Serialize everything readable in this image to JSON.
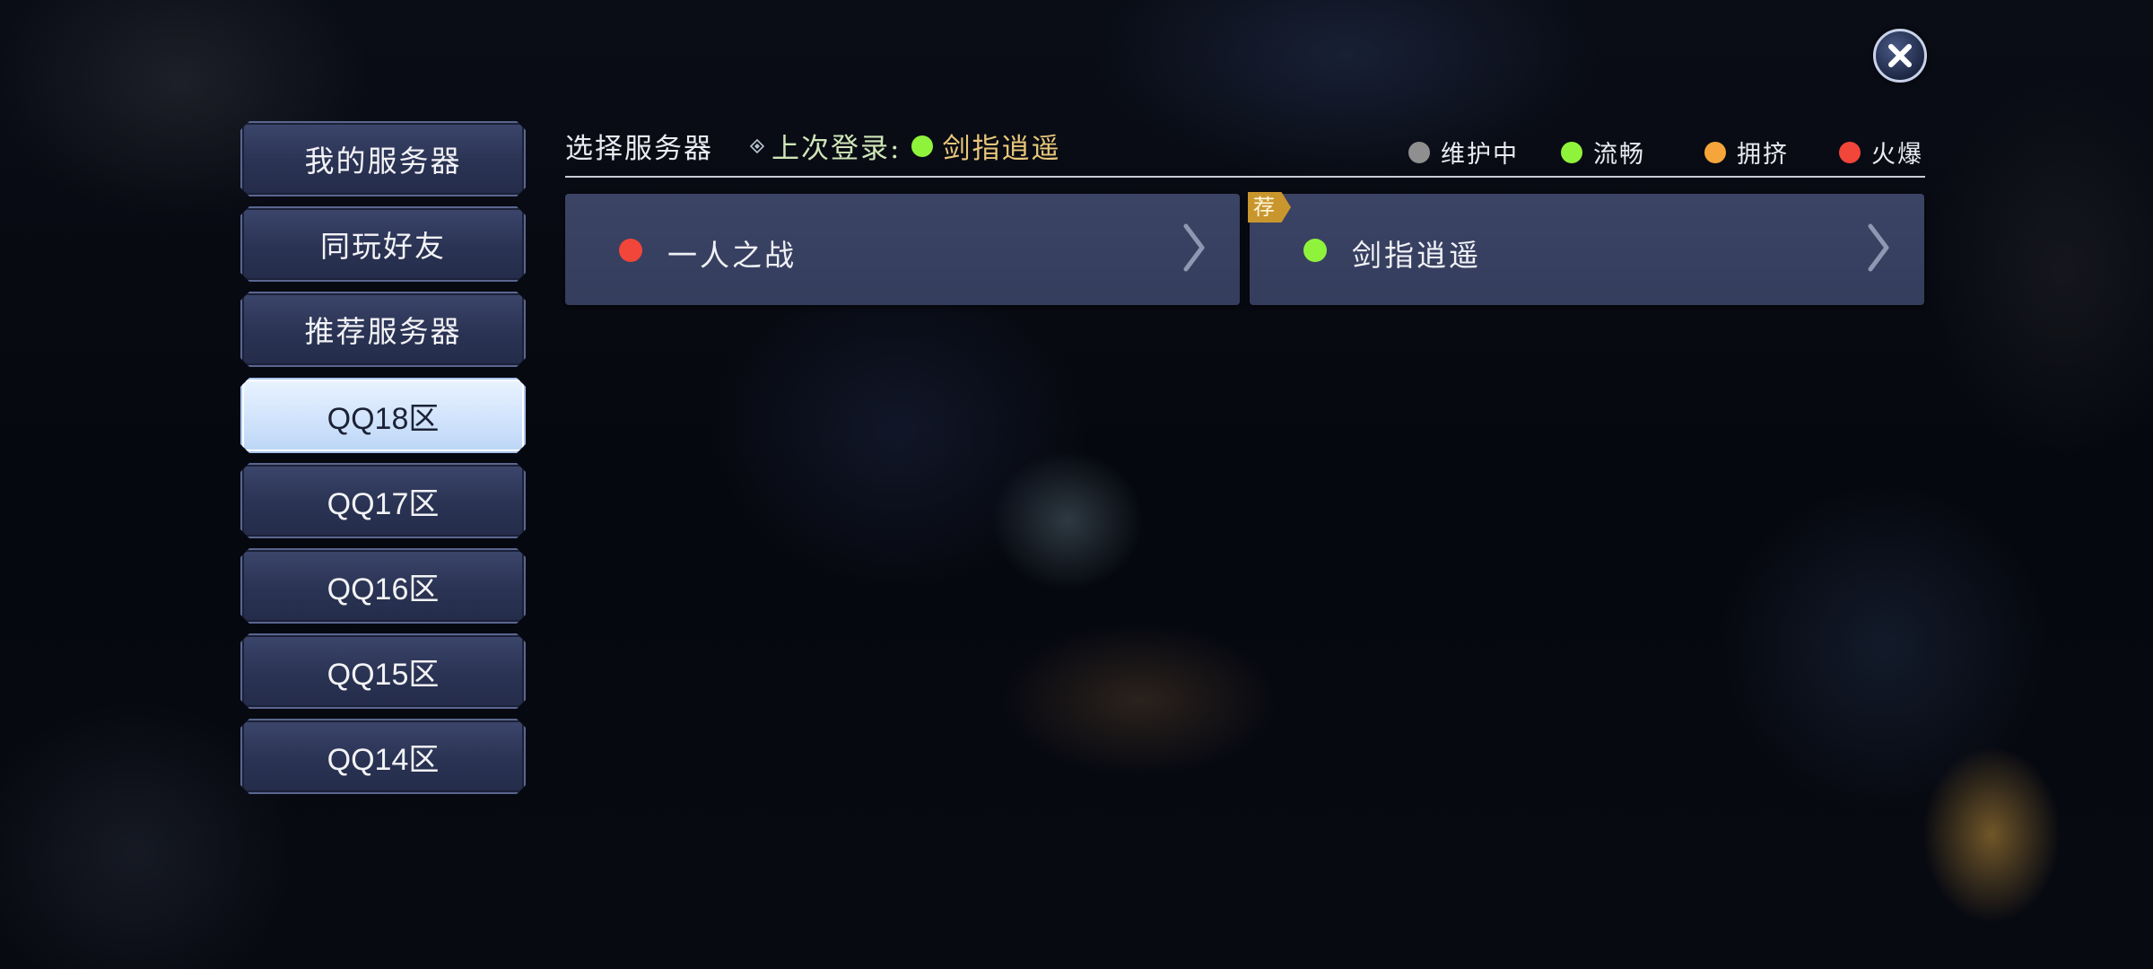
{
  "close": {
    "icon": "close-icon"
  },
  "sidebar": {
    "items": [
      {
        "label": "我的服务器",
        "active": false
      },
      {
        "label": "同玩好友",
        "active": false
      },
      {
        "label": "推荐服务器",
        "active": false
      },
      {
        "label": "QQ18区",
        "active": true
      },
      {
        "label": "QQ17区",
        "active": false
      },
      {
        "label": "QQ16区",
        "active": false
      },
      {
        "label": "QQ15区",
        "active": false
      },
      {
        "label": "QQ14区",
        "active": false
      }
    ]
  },
  "header": {
    "title": "选择服务器",
    "last_login_label": "上次登录:",
    "last_login_server": "剑指逍遥",
    "last_login_status_color": "#8ff33c"
  },
  "legend": [
    {
      "label": "维护中",
      "color": "#8f8f8f"
    },
    {
      "label": "流畅",
      "color": "#8ff33c"
    },
    {
      "label": "拥挤",
      "color": "#f6a53a"
    },
    {
      "label": "火爆",
      "color": "#f2463a"
    }
  ],
  "servers": [
    {
      "name": "一人之战",
      "status_color": "#f2463a",
      "badge": ""
    },
    {
      "name": "剑指逍遥",
      "status_color": "#8ff33c",
      "badge": "荐"
    }
  ]
}
